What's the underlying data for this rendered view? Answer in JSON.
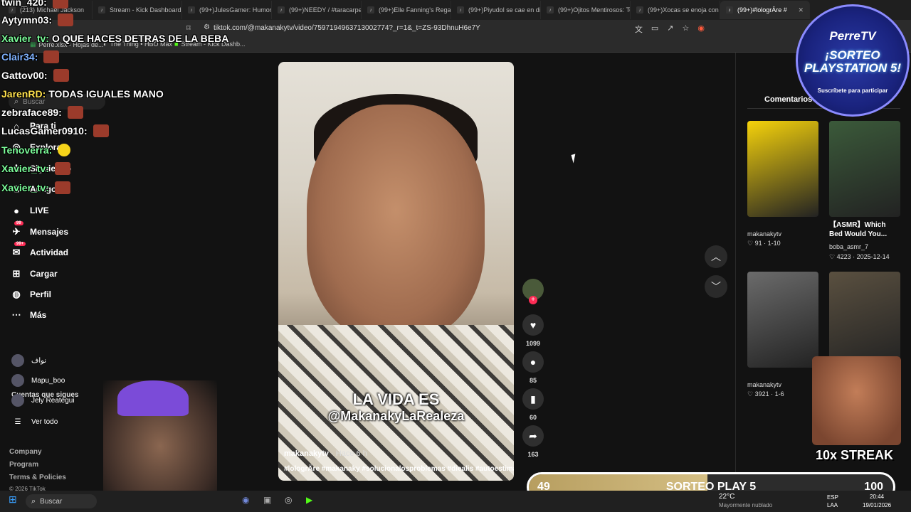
{
  "browser": {
    "tabs": [
      {
        "icon": "youtube-icon",
        "label": "(213) Michael Jackson"
      },
      {
        "icon": "kick-icon",
        "label": "Stream - Kick Dashboard"
      },
      {
        "icon": "tiktok-icon",
        "label": "(99+)JulesGamer: Humor y"
      },
      {
        "icon": "tiktok-icon",
        "label": "(99+)NEEDY / #taracarpen"
      },
      {
        "icon": "tiktok-icon",
        "label": "(99+)Elle Fanning's Regal"
      },
      {
        "icon": "tiktok-icon",
        "label": "(99+)Piyudol se cae en di"
      },
      {
        "icon": "tiktok-icon",
        "label": "(99+)Ojitos Mentirosos: Te"
      },
      {
        "icon": "tiktok-icon",
        "label": "(99+)Xocas se enoja con l"
      },
      {
        "icon": "tiktok-icon",
        "label": "(99+)#lologrÄre #",
        "active": true
      }
    ],
    "url": "tiktok.com/@makanakytv/video/7597194963713002774?_r=1&_t=ZS-93DhnuH6e7Y",
    "bookmarks": [
      "Perre.xlsx - Hojas de...",
      "The Thing • HBO Max",
      "Stream - Kick Dashb..."
    ]
  },
  "chat": [
    {
      "user": "twin_420:",
      "msg": "",
      "color": "#ffffff"
    },
    {
      "user": "Aytymn03:",
      "msg": "",
      "color": "#ffffff"
    },
    {
      "user": "Xavier_tv:",
      "msg": "O QUE HACES DETRAS DE LA BEBA",
      "color": "#7CFC9A"
    },
    {
      "user": "Clair34:",
      "msg": "",
      "color": "#7fb2ff"
    },
    {
      "user": "Gattov00:",
      "msg": "",
      "color": "#ffffff"
    },
    {
      "user": "JarenRD:",
      "msg": "TODAS IGUALES MANO",
      "color": "#ffe14d"
    },
    {
      "user": "zebraface89:",
      "msg": "",
      "color": "#ffffff"
    },
    {
      "user": "LucasGamer0910:",
      "msg": "",
      "color": "#ffffff"
    },
    {
      "user": "Tenoverra:",
      "msg": "",
      "color": "#7CFC9A"
    },
    {
      "user": "Xavier_tv:",
      "msg": "",
      "color": "#7CFC9A"
    },
    {
      "user": "Xavier_tv:",
      "msg": "",
      "color": "#7CFC9A"
    }
  ],
  "sidebar": {
    "search_placeholder": "Buscar",
    "items": [
      {
        "label": "Para ti",
        "icon": "home-icon"
      },
      {
        "label": "Explorar",
        "icon": "compass-icon"
      },
      {
        "label": "Siguiendo",
        "icon": "following-icon"
      },
      {
        "label": "Amigos",
        "icon": "friends-icon"
      },
      {
        "label": "LIVE",
        "icon": "live-icon"
      },
      {
        "label": "Mensajes",
        "icon": "messages-icon",
        "badge": "99"
      },
      {
        "label": "Actividad",
        "icon": "activity-icon",
        "badge": "99+"
      },
      {
        "label": "Cargar",
        "icon": "upload-icon"
      },
      {
        "label": "Perfil",
        "icon": "profile-icon"
      },
      {
        "label": "Más",
        "icon": "more-icon"
      }
    ],
    "following_title": "Cuentas que sigues",
    "following": [
      "نواف",
      "Mapu_boo",
      "Jely Reategui"
    ],
    "see_all": "Ver todo",
    "footer": [
      "Company",
      "Program",
      "Terms & Policies",
      "© 2026 TikTok"
    ]
  },
  "video": {
    "caption_line1": "LA VIDA ES",
    "caption_line2": "@MakanakyLaRealeza",
    "author": "makanakytv",
    "time": "· Hace 6 h",
    "tags": "#lologrÄre #makanaky #solucionalosproblemas #diealis #autoestima",
    "likes": "1099",
    "comments": "85",
    "saves": "60",
    "shares": "163"
  },
  "panel": {
    "tab": "Comentarios",
    "videos": [
      {
        "author": "makanakytv",
        "likes": "91",
        "date": "1-10",
        "title": "",
        "color": "#f5d20b"
      },
      {
        "author": "boba_asmr_7",
        "likes": "4223",
        "date": "2025-12-14",
        "title": "【ASMR】Which Bed Would You...",
        "color": "#3b5a3a"
      },
      {
        "author": "makanakytv",
        "likes": "3921",
        "date": "1-6",
        "title": "",
        "color": "#6b6b6b"
      },
      {
        "author": "",
        "likes": "",
        "date": "",
        "title": "",
        "color": "#5a5040"
      }
    ]
  },
  "overlay": {
    "promo_brand": "PerreTV",
    "promo_title": "¡SORTEO PLAYSTATION 5!",
    "promo_sub": "Suscríbete para participar",
    "streak": "10x STREAK",
    "progress_current": "49",
    "progress_label": "SORTEO PLAY 5",
    "progress_goal": "100",
    "progress_fraction": 0.49
  },
  "taskbar": {
    "search": "Buscar",
    "weather": "22°C",
    "weather_desc": "Mayormente nublado",
    "lang": "ESP",
    "lang2": "LAA",
    "time": "20:44",
    "date": "19/01/2026"
  }
}
